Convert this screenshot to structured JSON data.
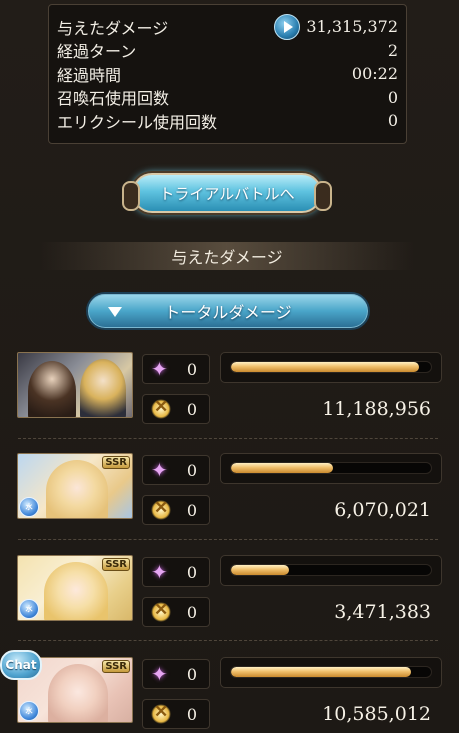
{
  "stats": {
    "rows": [
      {
        "label": "与えたダメージ",
        "value": "31,315,372"
      },
      {
        "label": "経過ターン",
        "value": "2"
      },
      {
        "label": "経過時間",
        "value": "00:22"
      },
      {
        "label": "召喚石使用回数",
        "value": "0"
      },
      {
        "label": "エリクシール使用回数",
        "value": "0"
      }
    ]
  },
  "trial_button": {
    "label": "トライアルバトルへ"
  },
  "section_title": "与えたダメージ",
  "dropdown": {
    "label": "トータルダメージ"
  },
  "characters": [
    {
      "skill_count": "0",
      "ougi_count": "0",
      "damage": "11,188,956",
      "bar_fill": 0.94,
      "ssr": "",
      "element": ""
    },
    {
      "skill_count": "0",
      "ougi_count": "0",
      "damage": "6,070,021",
      "bar_fill": 0.51,
      "ssr": "SSR",
      "element": "水"
    },
    {
      "skill_count": "0",
      "ougi_count": "0",
      "damage": "3,471,383",
      "bar_fill": 0.29,
      "ssr": "SSR",
      "element": "水"
    },
    {
      "skill_count": "0",
      "ougi_count": "0",
      "damage": "10,585,012",
      "bar_fill": 0.9,
      "ssr": "SSR",
      "element": "水"
    }
  ],
  "chat_button": {
    "label": "Chat"
  }
}
